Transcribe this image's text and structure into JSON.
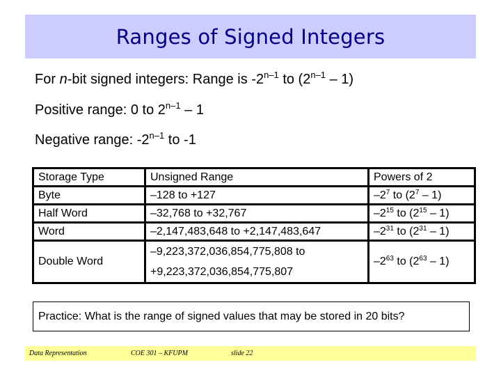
{
  "title": "Ranges of Signed Integers",
  "bullets": {
    "b1": {
      "pre_italic": "For ",
      "italic": "n",
      "text1": "-bit signed integers: Range is -2",
      "sup1": "n–1",
      "text2": " to (2",
      "sup2": "n–1",
      "text3": " – 1)"
    },
    "b2": {
      "text1": "Positive range: 0 to 2",
      "sup1": "n–1",
      "text2": " – 1"
    },
    "b3": {
      "text1": "Negative range: -2",
      "sup1": "n–1",
      "text2": " to -1"
    }
  },
  "table": {
    "headers": [
      "Storage Type",
      "Unsigned Range",
      "Powers of 2"
    ],
    "rows": [
      {
        "type": "Byte",
        "range": "–128 to +127",
        "pow_pre": "–2",
        "pow_exp": "7",
        "pow_mid": " to (2",
        "pow_exp2": "7",
        "pow_post": " – 1)"
      },
      {
        "type": "Half Word",
        "range": "–32,768 to +32,767",
        "pow_pre": "–2",
        "pow_exp": "15",
        "pow_mid": " to (2",
        "pow_exp2": "15",
        "pow_post": " – 1)"
      },
      {
        "type": "Word",
        "range": "–2,147,483,648 to +2,147,483,647",
        "pow_pre": "–2",
        "pow_exp": "31",
        "pow_mid": " to (2",
        "pow_exp2": "31",
        "pow_post": " – 1)"
      },
      {
        "type": "Double Word",
        "range_line1": "–9,223,372,036,854,775,808 to",
        "range_line2": "+9,223,372,036,854,775,807",
        "pow_pre": "–2",
        "pow_exp": "63",
        "pow_mid": " to (2",
        "pow_exp2": "63",
        "pow_post": " – 1)"
      }
    ]
  },
  "practice": "Practice: What is the range of signed values that may be stored in 20 bits?",
  "footer": {
    "topic": "Data Representation",
    "course": "COE 301 – KFUPM",
    "slide": "slide 22"
  },
  "colors": {
    "title_bg": "#ccccff",
    "title_text": "#000080",
    "footer_bg": "#ffff99"
  }
}
